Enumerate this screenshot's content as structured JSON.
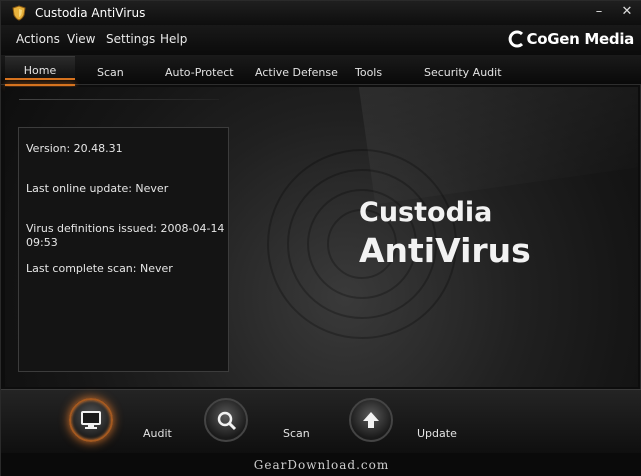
{
  "window": {
    "title": "Custodia AntiVirus",
    "controls": {
      "minimize": "–",
      "close": "✕"
    }
  },
  "menu": {
    "items": [
      "Actions",
      "View",
      "Settings",
      "Help"
    ],
    "brand": "CoGen Media"
  },
  "tabs": [
    "Home",
    "Scan",
    "Auto-Protect",
    "Active Defense",
    "Tools",
    "Security Audit"
  ],
  "active_tab": "Home",
  "info": {
    "version": "Version: 20.48.31",
    "last_online_update": "Last online update: Never",
    "virus_definitions_line1": "Virus definitions issued: 2008-04-14",
    "virus_definitions_line2": "09:53",
    "last_complete_scan": "Last complete scan: Never"
  },
  "product": {
    "line1": "Custodia",
    "line2": "AntiVirus"
  },
  "actions": [
    {
      "label": "Audit",
      "icon": "monitor-icon"
    },
    {
      "label": "Scan",
      "icon": "magnifier-icon"
    },
    {
      "label": "Update",
      "icon": "up-arrow-icon"
    }
  ],
  "footer": {
    "watermark": "GearDownload.com"
  },
  "colors": {
    "accent": "#d6731f",
    "background": "#0d0d0d",
    "text": "#e6e6e6"
  }
}
